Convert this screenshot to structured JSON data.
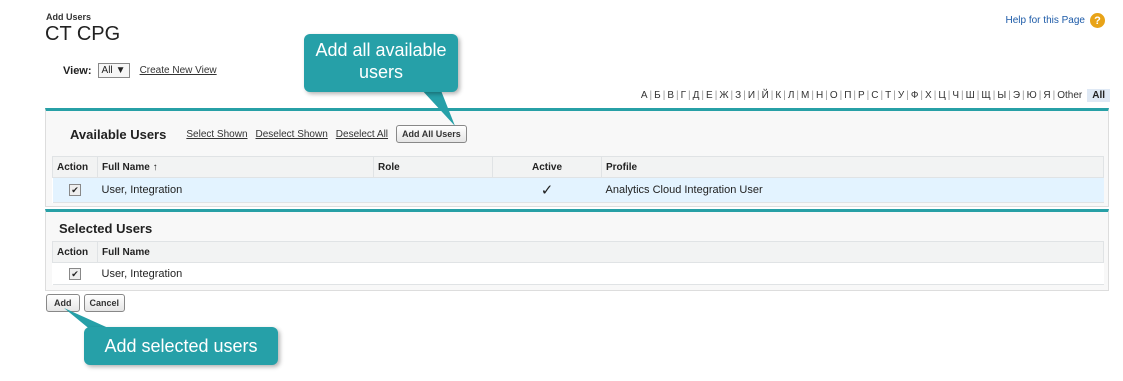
{
  "header": {
    "section": "Add Users",
    "title": "CT CPG",
    "help_label": "Help for this Page",
    "help_icon": "?"
  },
  "view": {
    "label": "View:",
    "selected": "All",
    "create_link": "Create New View"
  },
  "alphabet": [
    "А",
    "Б",
    "В",
    "Г",
    "Д",
    "Е",
    "Ж",
    "З",
    "И",
    "Й",
    "К",
    "Л",
    "М",
    "Н",
    "О",
    "П",
    "Р",
    "С",
    "Т",
    "У",
    "Ф",
    "Х",
    "Ц",
    "Ч",
    "Ш",
    "Щ",
    "Ы",
    "Э",
    "Ю",
    "Я",
    "Other"
  ],
  "alphabet_all": "All",
  "available": {
    "title": "Available Users",
    "links": {
      "select_shown": "Select Shown",
      "deselect_shown": "Deselect Shown",
      "deselect_all": "Deselect All"
    },
    "add_all_button": "Add All Users",
    "columns": {
      "action": "Action",
      "full_name": "Full Name ↑",
      "role": "Role",
      "active": "Active",
      "profile": "Profile"
    },
    "rows": [
      {
        "checked": "✔",
        "full_name": "User, Integration",
        "role": "",
        "active": "✓",
        "profile": "Analytics Cloud Integration User"
      }
    ]
  },
  "selected": {
    "title": "Selected Users",
    "columns": {
      "action": "Action",
      "full_name": "Full Name"
    },
    "rows": [
      {
        "checked": "✔",
        "full_name": "User, Integration"
      }
    ]
  },
  "buttons": {
    "add": "Add",
    "cancel": "Cancel"
  },
  "callouts": {
    "add_all": "Add all available users",
    "add_selected": "Add selected users"
  },
  "colors": {
    "accent": "#27a0a6",
    "callout": "#26a0a8",
    "highlight_row": "#e3f3ff",
    "link": "#1d5ba8"
  }
}
